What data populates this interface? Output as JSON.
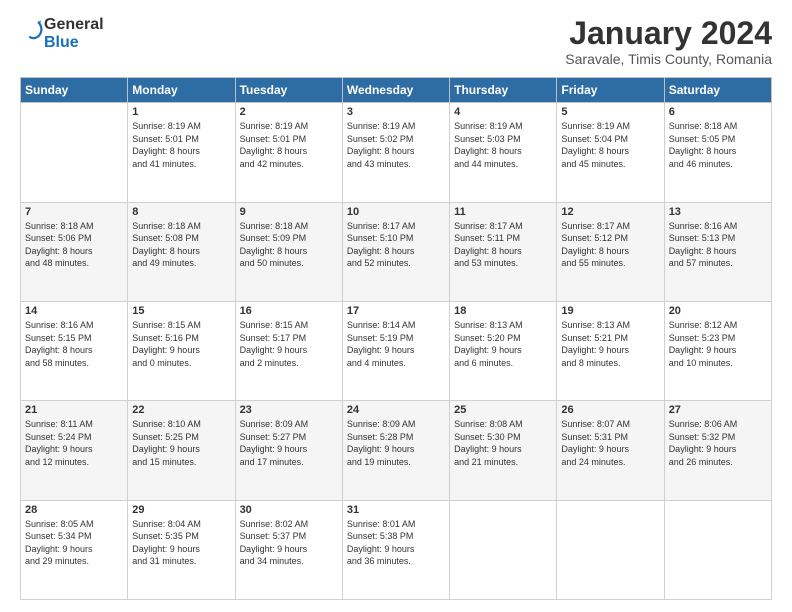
{
  "logo": {
    "general": "General",
    "blue": "Blue"
  },
  "header": {
    "month": "January 2024",
    "location": "Saravale, Timis County, Romania"
  },
  "weekdays": [
    "Sunday",
    "Monday",
    "Tuesday",
    "Wednesday",
    "Thursday",
    "Friday",
    "Saturday"
  ],
  "weeks": [
    [
      {
        "day": "",
        "info": ""
      },
      {
        "day": "1",
        "info": "Sunrise: 8:19 AM\nSunset: 5:01 PM\nDaylight: 8 hours\nand 41 minutes."
      },
      {
        "day": "2",
        "info": "Sunrise: 8:19 AM\nSunset: 5:01 PM\nDaylight: 8 hours\nand 42 minutes."
      },
      {
        "day": "3",
        "info": "Sunrise: 8:19 AM\nSunset: 5:02 PM\nDaylight: 8 hours\nand 43 minutes."
      },
      {
        "day": "4",
        "info": "Sunrise: 8:19 AM\nSunset: 5:03 PM\nDaylight: 8 hours\nand 44 minutes."
      },
      {
        "day": "5",
        "info": "Sunrise: 8:19 AM\nSunset: 5:04 PM\nDaylight: 8 hours\nand 45 minutes."
      },
      {
        "day": "6",
        "info": "Sunrise: 8:18 AM\nSunset: 5:05 PM\nDaylight: 8 hours\nand 46 minutes."
      }
    ],
    [
      {
        "day": "7",
        "info": "Sunrise: 8:18 AM\nSunset: 5:06 PM\nDaylight: 8 hours\nand 48 minutes."
      },
      {
        "day": "8",
        "info": "Sunrise: 8:18 AM\nSunset: 5:08 PM\nDaylight: 8 hours\nand 49 minutes."
      },
      {
        "day": "9",
        "info": "Sunrise: 8:18 AM\nSunset: 5:09 PM\nDaylight: 8 hours\nand 50 minutes."
      },
      {
        "day": "10",
        "info": "Sunrise: 8:17 AM\nSunset: 5:10 PM\nDaylight: 8 hours\nand 52 minutes."
      },
      {
        "day": "11",
        "info": "Sunrise: 8:17 AM\nSunset: 5:11 PM\nDaylight: 8 hours\nand 53 minutes."
      },
      {
        "day": "12",
        "info": "Sunrise: 8:17 AM\nSunset: 5:12 PM\nDaylight: 8 hours\nand 55 minutes."
      },
      {
        "day": "13",
        "info": "Sunrise: 8:16 AM\nSunset: 5:13 PM\nDaylight: 8 hours\nand 57 minutes."
      }
    ],
    [
      {
        "day": "14",
        "info": "Sunrise: 8:16 AM\nSunset: 5:15 PM\nDaylight: 8 hours\nand 58 minutes."
      },
      {
        "day": "15",
        "info": "Sunrise: 8:15 AM\nSunset: 5:16 PM\nDaylight: 9 hours\nand 0 minutes."
      },
      {
        "day": "16",
        "info": "Sunrise: 8:15 AM\nSunset: 5:17 PM\nDaylight: 9 hours\nand 2 minutes."
      },
      {
        "day": "17",
        "info": "Sunrise: 8:14 AM\nSunset: 5:19 PM\nDaylight: 9 hours\nand 4 minutes."
      },
      {
        "day": "18",
        "info": "Sunrise: 8:13 AM\nSunset: 5:20 PM\nDaylight: 9 hours\nand 6 minutes."
      },
      {
        "day": "19",
        "info": "Sunrise: 8:13 AM\nSunset: 5:21 PM\nDaylight: 9 hours\nand 8 minutes."
      },
      {
        "day": "20",
        "info": "Sunrise: 8:12 AM\nSunset: 5:23 PM\nDaylight: 9 hours\nand 10 minutes."
      }
    ],
    [
      {
        "day": "21",
        "info": "Sunrise: 8:11 AM\nSunset: 5:24 PM\nDaylight: 9 hours\nand 12 minutes."
      },
      {
        "day": "22",
        "info": "Sunrise: 8:10 AM\nSunset: 5:25 PM\nDaylight: 9 hours\nand 15 minutes."
      },
      {
        "day": "23",
        "info": "Sunrise: 8:09 AM\nSunset: 5:27 PM\nDaylight: 9 hours\nand 17 minutes."
      },
      {
        "day": "24",
        "info": "Sunrise: 8:09 AM\nSunset: 5:28 PM\nDaylight: 9 hours\nand 19 minutes."
      },
      {
        "day": "25",
        "info": "Sunrise: 8:08 AM\nSunset: 5:30 PM\nDaylight: 9 hours\nand 21 minutes."
      },
      {
        "day": "26",
        "info": "Sunrise: 8:07 AM\nSunset: 5:31 PM\nDaylight: 9 hours\nand 24 minutes."
      },
      {
        "day": "27",
        "info": "Sunrise: 8:06 AM\nSunset: 5:32 PM\nDaylight: 9 hours\nand 26 minutes."
      }
    ],
    [
      {
        "day": "28",
        "info": "Sunrise: 8:05 AM\nSunset: 5:34 PM\nDaylight: 9 hours\nand 29 minutes."
      },
      {
        "day": "29",
        "info": "Sunrise: 8:04 AM\nSunset: 5:35 PM\nDaylight: 9 hours\nand 31 minutes."
      },
      {
        "day": "30",
        "info": "Sunrise: 8:02 AM\nSunset: 5:37 PM\nDaylight: 9 hours\nand 34 minutes."
      },
      {
        "day": "31",
        "info": "Sunrise: 8:01 AM\nSunset: 5:38 PM\nDaylight: 9 hours\nand 36 minutes."
      },
      {
        "day": "",
        "info": ""
      },
      {
        "day": "",
        "info": ""
      },
      {
        "day": "",
        "info": ""
      }
    ]
  ]
}
